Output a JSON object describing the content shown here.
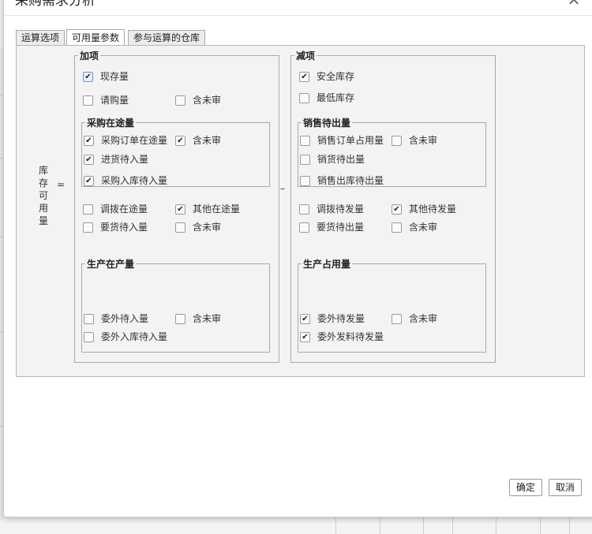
{
  "dialog": {
    "title": "采购需求分析",
    "close_glyph": "×",
    "tabs": [
      {
        "label": "运算选项"
      },
      {
        "label": "可用量参数"
      },
      {
        "label": "参与运算的仓库"
      }
    ],
    "ok_label": "确定",
    "cancel_label": "取消"
  },
  "formula": {
    "vertical_label": "库存可用量",
    "equals": "=",
    "minus": "–"
  },
  "add_section": {
    "legend": "加项",
    "onhand": {
      "label": "现存量",
      "checked": true
    },
    "request": {
      "label": "请购量",
      "checked": false
    },
    "request_unaudited": {
      "label": "含未审",
      "checked": false
    },
    "purchase_transit": {
      "legend": "采购在途量",
      "po_transit": {
        "label": "采购订单在途量",
        "checked": true
      },
      "po_unaudited": {
        "label": "含未审",
        "checked": true
      },
      "arrival_pending": {
        "label": "进货待入量",
        "checked": true
      },
      "purchase_inbound_pending": {
        "label": "采购入库待入量",
        "checked": true
      }
    },
    "transfer_transit": {
      "label": "调拨在途量",
      "checked": false
    },
    "other_transit": {
      "label": "其他在途量",
      "checked": true
    },
    "requisition_pending": {
      "label": "要货待入量",
      "checked": false
    },
    "requisition_unaudited": {
      "label": "含未审",
      "checked": false
    },
    "production_in_progress": {
      "legend": "生产在产量",
      "outsourced_inbound": {
        "label": "委外待入量",
        "checked": false
      },
      "outsourced_unaudited": {
        "label": "含未审",
        "checked": false
      },
      "outsourced_warehouse_inbound": {
        "label": "委外入库待入量",
        "checked": false
      }
    }
  },
  "subtract_section": {
    "legend": "减项",
    "safety_stock": {
      "label": "安全库存",
      "checked": true
    },
    "min_stock": {
      "label": "最低库存",
      "checked": false
    },
    "sales_pending_out": {
      "legend": "销售待出量",
      "so_reserved": {
        "label": "销售订单占用量",
        "checked": false
      },
      "so_unaudited": {
        "label": "含未审",
        "checked": false
      },
      "delivery_pending": {
        "label": "销货待出量",
        "checked": false
      },
      "sales_outbound_pending": {
        "label": "销售出库待出量",
        "checked": false
      }
    },
    "transfer_pending": {
      "label": "调拨待发量",
      "checked": false
    },
    "other_pending": {
      "label": "其他待发量",
      "checked": true
    },
    "requisition_pending_out": {
      "label": "要货待出量",
      "checked": false
    },
    "requisition_out_unaudited": {
      "label": "含未审",
      "checked": false
    },
    "production_usage": {
      "legend": "生产占用量",
      "outsourced_issue": {
        "label": "委外待发量",
        "checked": true
      },
      "outsourced_issue_unaudited": {
        "label": "含未审",
        "checked": false
      },
      "outsourced_material_issue": {
        "label": "委外发料待发量",
        "checked": true
      }
    }
  },
  "check_glyph": "✔"
}
